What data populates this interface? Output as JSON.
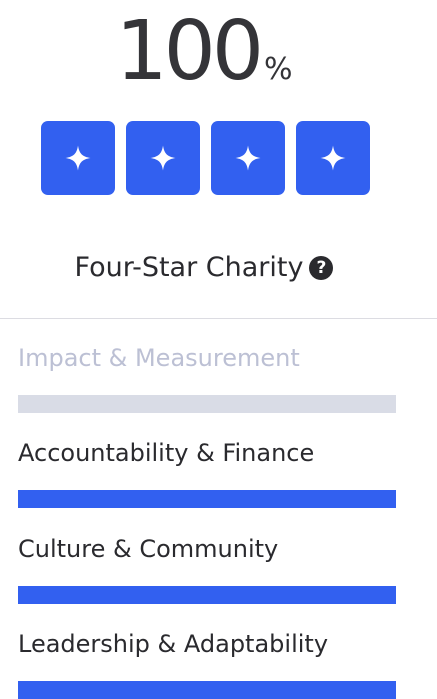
{
  "score": {
    "value": "100",
    "unit": "%"
  },
  "rating": {
    "stars": 4,
    "label": "Four-Star Charity",
    "help_icon": "question-circle-icon",
    "star_icon": "four-point-star-icon"
  },
  "categories": [
    {
      "label": "Impact & Measurement",
      "progress": 0,
      "muted": true
    },
    {
      "label": "Accountability & Finance",
      "progress": 1.0,
      "muted": false
    },
    {
      "label": "Culture & Community",
      "progress": 1.0,
      "muted": false
    },
    {
      "label": "Leadership & Adaptability",
      "progress": 1.0,
      "muted": false
    }
  ],
  "colors": {
    "accent": "#3260f0",
    "bar_track": "#d9dce6",
    "muted_text": "#bcc0d4",
    "text": "#2a2a2e"
  }
}
